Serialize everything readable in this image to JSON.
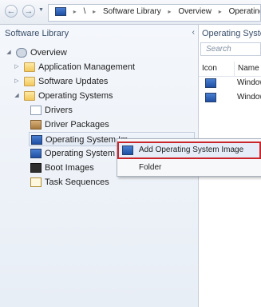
{
  "toolbar": {
    "back_glyph": "←",
    "forward_glyph": "→",
    "dropdown_glyph": "▼",
    "breadcrumb": [
      "\\",
      "Software Library",
      "Overview",
      "Operating S"
    ],
    "separator": "▸"
  },
  "left_pane": {
    "title": "Software Library",
    "collapse_glyph": "‹",
    "tree": {
      "root": "Overview",
      "items": [
        "Application Management",
        "Software Updates",
        "Operating Systems"
      ],
      "children": [
        "Drivers",
        "Driver Packages",
        "Operating System Im",
        "Operating System Ins",
        "Boot Images",
        "Task Sequences"
      ]
    }
  },
  "right_pane": {
    "title": "Operating Syste",
    "search_placeholder": "Search",
    "columns": [
      "Icon",
      "Name"
    ],
    "rows": [
      "Window",
      "Window"
    ]
  },
  "context_menu": {
    "items": [
      "Add Operating System Image",
      "Folder"
    ]
  },
  "colors": {
    "highlight_border": "#c9252b",
    "accent": "#2a5ca8"
  }
}
